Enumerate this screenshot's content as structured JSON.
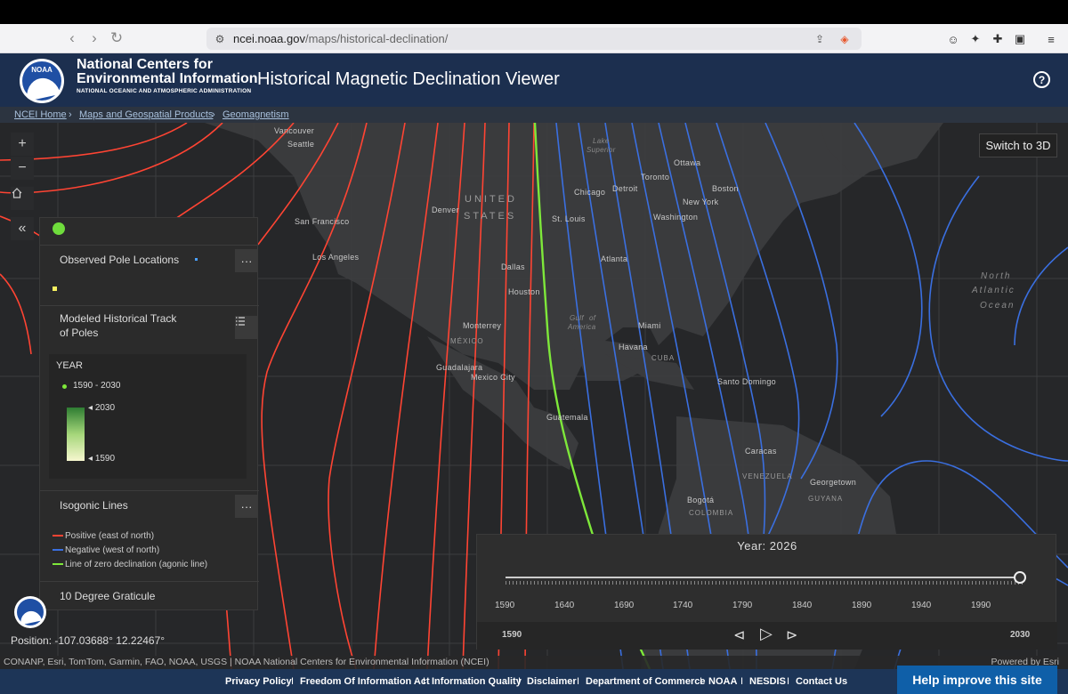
{
  "browser": {
    "url_domain": "ncei.noaa.gov",
    "url_path": "/maps/historical-declination/"
  },
  "header": {
    "org_line1": "National Centers for",
    "org_line2": "Environmental Information",
    "org_line3": "NATIONAL OCEANIC AND ATMOSPHERIC ADMINISTRATION",
    "logo_text": "NOAA",
    "app_title": "Historical Magnetic Declination Viewer",
    "help_label": "?"
  },
  "breadcrumbs": [
    "NCEI Home",
    "Maps and Geospatial Products",
    "Geomagnetism"
  ],
  "breadcrumb_separator": "›",
  "map_controls": {
    "zoom_in": "+",
    "zoom_out": "−",
    "collapse": "«",
    "switch_3d": "Switch to 3D"
  },
  "map_labels": {
    "cities": [
      "Vancouver",
      "Seattle",
      "San Francisco",
      "Los Angeles",
      "Denver",
      "Dallas",
      "Houston",
      "Monterrey",
      "Guadalajara",
      "Mexico City",
      "Chicago",
      "Detroit",
      "Toronto",
      "Ottawa",
      "Boston",
      "New York",
      "Washington",
      "St. Louis",
      "Atlanta",
      "Miami",
      "Havana",
      "Guatemala",
      "Santo Domingo",
      "Caracas",
      "Georgetown",
      "Bogotá"
    ],
    "countries": [
      "UNITED",
      "STATES",
      "MÉXICO",
      "CUBA",
      "VENEZUELA",
      "GUYANA",
      "COLOMBIA"
    ],
    "water": [
      "Lake",
      "Superior",
      "Gulf",
      "of",
      "America",
      "North",
      "Atlantic",
      "Ocean"
    ]
  },
  "legend": {
    "observed_pole_locations": "Observed Pole Locations",
    "modeled_track": "Modeled Historical Track of Poles",
    "year_label": "YEAR",
    "year_range": "1590 - 2030",
    "grad_max": "2030",
    "grad_min": "1590",
    "isogonic_lines": "Isogonic Lines",
    "iso_items": [
      {
        "label": "Positive (east of north)",
        "color": "#ff4433"
      },
      {
        "label": "Negative (west of north)",
        "color": "#3a6fe0"
      },
      {
        "label": "Line of zero declination (agonic line)",
        "color": "#7ee83a"
      }
    ],
    "graticule": "10 Degree Graticule",
    "more": "···"
  },
  "time_slider": {
    "title": "Year: 2026",
    "ticks": [
      "1590",
      "1640",
      "1690",
      "1740",
      "1790",
      "1840",
      "1890",
      "1940",
      "1990"
    ],
    "start": "1590",
    "end": "2030",
    "current_fraction": 0.99,
    "prev": "⊲",
    "play": "▷",
    "next": "⊳"
  },
  "position": "Position: -107.03688° 12.22467°",
  "attribution": "CONANP, Esri, TomTom, Garmin, FAO, NOAA, USGS | NOAA National Centers for Environmental Information (NCEI)",
  "powered_by": "Powered by Esri",
  "footer": {
    "links": [
      "Privacy Policy",
      "Freedom Of Information Act",
      "Information Quality",
      "Disclaimer",
      "Department of Commerce",
      "NOAA",
      "NESDIS",
      "Contact Us"
    ],
    "separator": "I",
    "help_improve": "Help improve this site"
  },
  "colors": {
    "positive": "#ff4433",
    "negative": "#3a6fe0",
    "agonic": "#7ee83a",
    "header_bg": "#1c2f4f"
  }
}
